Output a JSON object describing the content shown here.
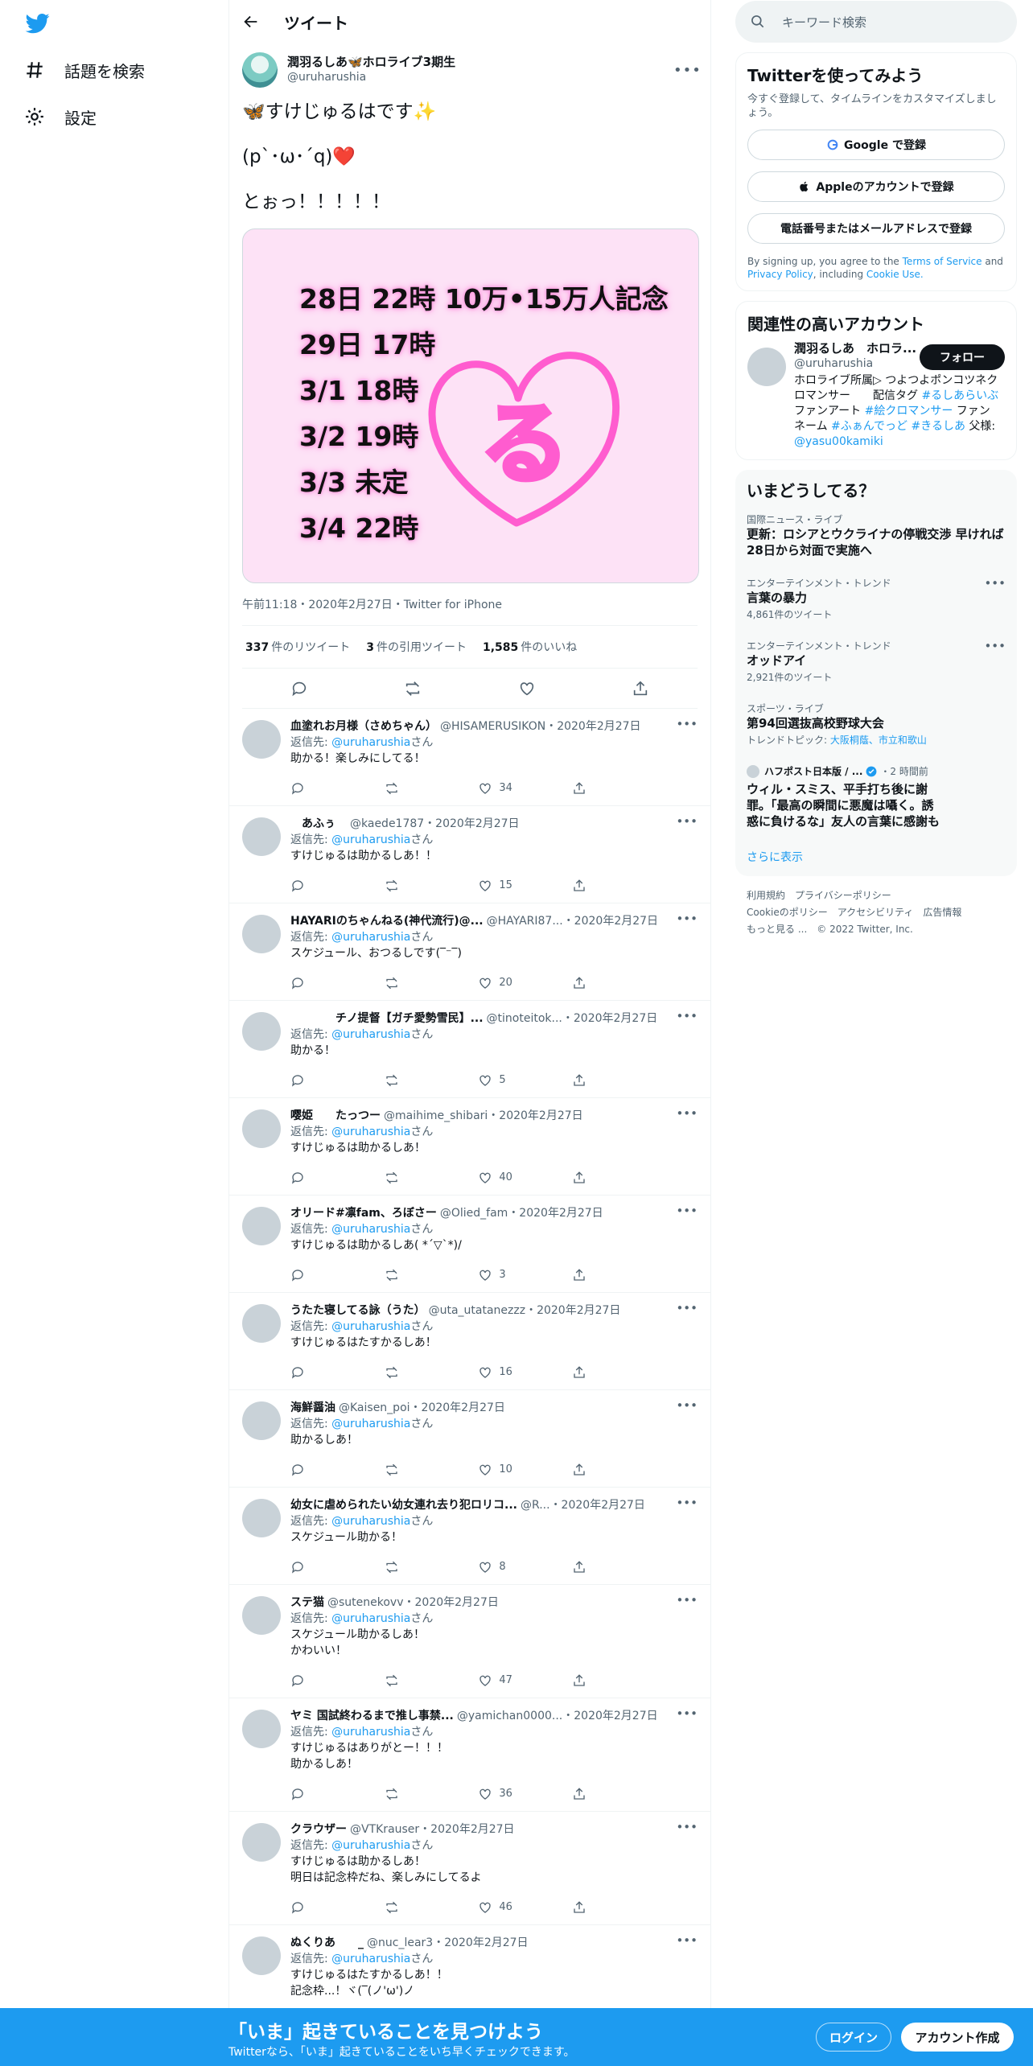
{
  "nav": {
    "explore_label": "話題を検索",
    "settings_label": "設定"
  },
  "header": {
    "title": "ツイート"
  },
  "main_tweet": {
    "name": "潤羽るしあ🦋ホロライブ3期生",
    "handle": "@uruharushia",
    "line1": "🦋すけじゅるはです✨",
    "line2": "(p`･ω･´q)❤️",
    "line3": "とぉっ！！！！！",
    "image_lines": [
      "28日 22時 10万•15万人記念",
      "29日 17時",
      "3/1 18時",
      "3/2 19時",
      "3/3 未定",
      "3/4 22時"
    ],
    "image_heart_char": "る",
    "meta": "午前11:18・2020年2月27日・Twitter for iPhone",
    "retweets": "337",
    "retweets_label": "件のリツイート",
    "quotes": "3",
    "quotes_label": "件の引用ツイート",
    "likes": "1,585",
    "likes_label": "件のいいね"
  },
  "reply_to_prefix": "返信先: ",
  "reply_to_handle": "@uruharushia",
  "reply_to_suffix": "さん",
  "replies": [
    {
      "name": "血塗れお月様（さめちゃん）",
      "handle": "@HISAMERUSIKON",
      "date": "・2020年2月27日",
      "text": "助かる！楽しみにしてる！",
      "likes": "34"
    },
    {
      "name": "　あふぅ　",
      "handle": "@kaede1787",
      "date": "・2020年2月27日",
      "text": "すけじゅるは助かるしあ！！",
      "likes": "15"
    },
    {
      "name": "HAYARIのちゃんねる(神代流行)@...",
      "handle": "@HAYARI87...",
      "date": "・2020年2月27日",
      "text": "スケジュール、おつるしです(‾⁻‾)",
      "likes": "20"
    },
    {
      "name": "　　　　チノ提督【ガチ愛勢雪民】...",
      "handle": "@tinoteitok...",
      "date": "・2020年2月27日",
      "text": "助かる！",
      "likes": "5"
    },
    {
      "name": "嘤姫　　たっつー",
      "handle": "@maihime_shibari",
      "date": "・2020年2月27日",
      "text": "すけじゅるは助かるしあ！",
      "likes": "40"
    },
    {
      "name": "オリード#凛fam、ろぼさー",
      "handle": "@Olied_fam",
      "date": "・2020年2月27日",
      "text": "すけじゅるは助かるしあ( *´▽`*)/",
      "likes": "3"
    },
    {
      "name": "うたた寝してる詠（うた）",
      "handle": "@uta_utatanezzz",
      "date": "・2020年2月27日",
      "text": "すけじゅるはたすかるしあ！",
      "likes": "16"
    },
    {
      "name": "海鮮醤油",
      "handle": "@Kaisen_poi",
      "date": "・2020年2月27日",
      "text": "助かるしあ！",
      "likes": "10"
    },
    {
      "name": "幼女に虐められたい幼女連れ去り犯ロリコ...",
      "handle": "@R...",
      "date": "・2020年2月27日",
      "text": "スケジュール助かる！",
      "likes": "8"
    },
    {
      "name": "ステ猫",
      "handle": "@sutenekovv",
      "date": "・2020年2月27日",
      "text": "スケジュール助かるしあ！\nかわいい！",
      "likes": "47"
    },
    {
      "name": "ヤミ 国試終わるまで推し事禁...",
      "handle": "@yamichan0000...",
      "date": "・2020年2月27日",
      "text": "すけじゅるはありがとー！！！\n助かるしあ！",
      "likes": "36"
    },
    {
      "name": "クラウザー",
      "handle": "@VTKrauser",
      "date": "・2020年2月27日",
      "text": "すけじゅるは助かるしあ！\n明日は記念枠だね、楽しみにしてるよ",
      "likes": "46"
    },
    {
      "name": "ぬくりあ　　_",
      "handle": "@nuc_lear3",
      "date": "・2020年2月27日",
      "text": "すけじゅるはたすかるしあ！！\n記念枠...！ヾ(‾(ノ'ω')ノ",
      "likes": ""
    }
  ],
  "right": {
    "search_placeholder": "キーワード検索",
    "signup_title": "Twitterを使ってみよう",
    "signup_sub": "今すぐ登録して、タイムラインをカスタマイズしましょう。",
    "google_btn": "Google で登録",
    "apple_btn": "Appleのアカウントで登録",
    "phone_btn": "電話番号またはメールアドレスで登録",
    "legal_1": "By signing up, you agree to the ",
    "legal_terms": "Terms of Service",
    "legal_2": " and ",
    "legal_privacy": "Privacy Policy",
    "legal_3": ", including ",
    "legal_cookie": "Cookie Use.",
    "related_title": "関連性の高いアカウント",
    "related_name": "潤羽るしあ　ホロラ...",
    "related_handle": "@uruharushia",
    "follow_btn": "フォロー",
    "bio_1": "ホロライブ所属▷ つよつよポンコツネクロマンサー　　配信タグ ",
    "bio_tag1": "#るしあらいぶ",
    "bio_2": " ファンアート ",
    "bio_tag2": "#絵クロマンサー",
    "bio_3": " ファンネーム ",
    "bio_tag3": "#ふぁんでっど",
    "bio_tag4": "#きるしあ",
    "bio_4": " 父様: ",
    "bio_tag5": "@yasu00kamiki",
    "trends_title": "いまどうしてる？",
    "trends": [
      {
        "meta": "国際ニュース・ライブ",
        "title": "更新：ロシアとウクライナの停戦交渉 早ければ28日から対面で実施へ",
        "count": ""
      },
      {
        "meta": "エンターテインメント・トレンド",
        "title": "言葉の暴力",
        "count": "4,861件のツイート"
      },
      {
        "meta": "エンターテインメント・トレンド",
        "title": "オッドアイ",
        "count": "2,921件のツイート"
      },
      {
        "meta": "スポーツ・ライブ",
        "title": "第94回選抜高校野球大会",
        "count": ""
      }
    ],
    "trend_topics_label": "トレンドトピック: ",
    "trend_topics": "大阪桐蔭、市立和歌山",
    "news_source": "ハフポスト日本版 / ...",
    "news_time": "・2 時間前",
    "news_title": "ウィル・スミス、平手打ち後に謝罪。「最高の瞬間に悪魔は囁く。誘惑に負けるな」友人の言葉に感謝も",
    "more": "さらに表示",
    "footer_line1": "利用規約　プライバシーポリシー",
    "footer_line2": "Cookieのポリシー　アクセシビリティ　広告情報",
    "footer_line3": "もっと見る ...　© 2022 Twitter, Inc."
  },
  "bottom": {
    "title": "「いま」起きていることを見つけよう",
    "sub": "Twitterなら、「いま」起きていることをいち早くチェックできます。",
    "login": "ログイン",
    "signup": "アカウント作成"
  },
  "colors": {
    "accent": "#1d9bf0",
    "bottom_bar": "#1d9bf0",
    "media_bg": "#fde2f6",
    "heart": "#ff5ccf"
  }
}
